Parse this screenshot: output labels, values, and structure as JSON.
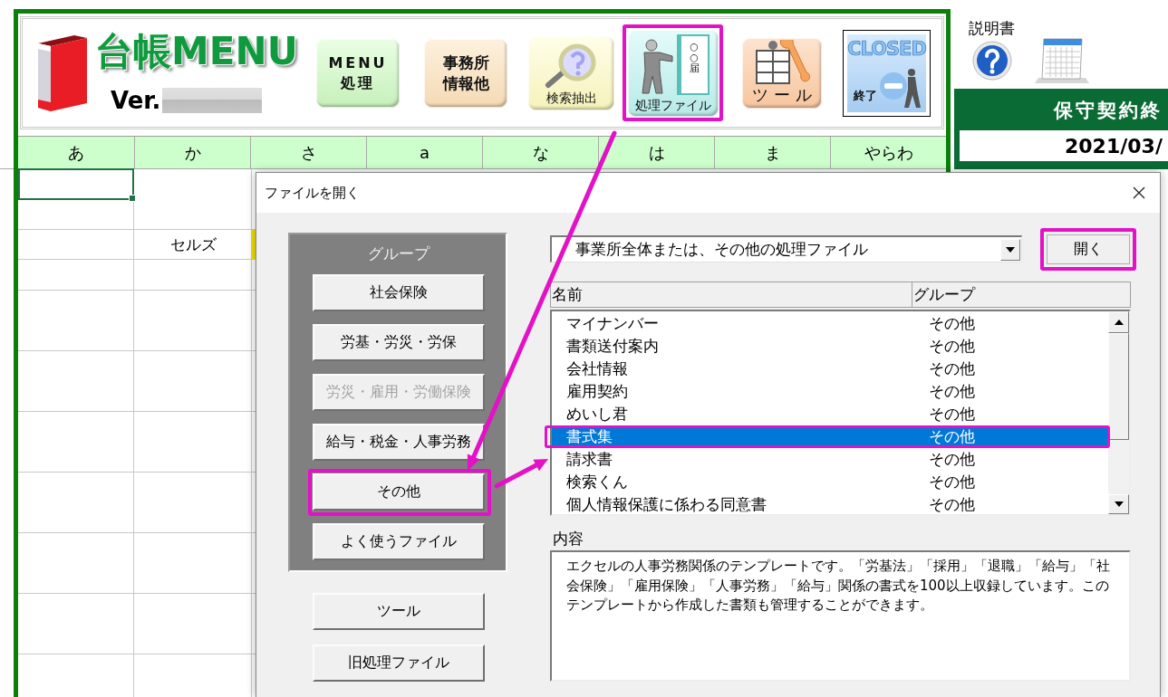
{
  "header": {
    "title": "台帳MENU",
    "version_label": "Ver.",
    "buttons": [
      {
        "kind": "menu",
        "lines": [
          "MENU",
          "処理"
        ],
        "highlighted": false
      },
      {
        "kind": "office",
        "lines": [
          "事務所",
          "情報他"
        ],
        "highlighted": false
      },
      {
        "kind": "search",
        "lines": [
          "検索抽出"
        ],
        "highlighted": false
      },
      {
        "kind": "files",
        "lines": [
          "処理ファイル"
        ],
        "icon_text": "○○届",
        "highlighted": true
      },
      {
        "kind": "tools",
        "lines": [
          "ツール"
        ],
        "highlighted": false
      },
      {
        "kind": "close",
        "lines": [
          "CLOSED",
          "終了"
        ],
        "highlighted": false
      }
    ]
  },
  "index_tabs": [
    {
      "label": "あ",
      "selected": false
    },
    {
      "label": "か",
      "selected": false
    },
    {
      "label": "さ",
      "selected": false
    },
    {
      "label": "a",
      "selected": false
    },
    {
      "label": "な",
      "selected": false
    },
    {
      "label": "は",
      "selected": false
    },
    {
      "label": "ま",
      "selected": false
    },
    {
      "label": "やらわ",
      "selected": false
    }
  ],
  "sheet": {
    "cell_text": "セルズ"
  },
  "manual": {
    "label": "説明書"
  },
  "contract_panel": {
    "title": "保守契約終",
    "date": "2021/03/"
  },
  "dialog": {
    "title": "ファイルを開く",
    "group_panel": {
      "title": "グループ",
      "buttons": [
        {
          "label": "社会保険",
          "disabled": false,
          "highlighted": false
        },
        {
          "label": "労基・労災・労保",
          "disabled": false,
          "highlighted": false
        },
        {
          "label": "労災・雇用・労働保険",
          "disabled": true,
          "highlighted": false
        },
        {
          "label": "給与・税金・人事労務",
          "disabled": false,
          "highlighted": false
        },
        {
          "label": "その他",
          "disabled": false,
          "highlighted": true
        },
        {
          "label": "よく使うファイル",
          "disabled": false,
          "highlighted": false
        }
      ]
    },
    "extra_buttons": [
      {
        "label": "ツール"
      },
      {
        "label": "旧処理ファイル"
      }
    ],
    "category_select": {
      "value": "事業所全体または、その他の処理ファイル"
    },
    "open_button": {
      "label": "開く",
      "highlighted": true
    },
    "file_list": {
      "columns": [
        "名前",
        "グループ"
      ],
      "rows": [
        {
          "name": "マイナンバー",
          "group": "その他",
          "selected": false,
          "highlighted": false
        },
        {
          "name": "書類送付案内",
          "group": "その他",
          "selected": false,
          "highlighted": false
        },
        {
          "name": "会社情報",
          "group": "その他",
          "selected": false,
          "highlighted": false
        },
        {
          "name": "雇用契約",
          "group": "その他",
          "selected": false,
          "highlighted": false
        },
        {
          "name": "めいし君",
          "group": "その他",
          "selected": false,
          "highlighted": false
        },
        {
          "name": "書式集",
          "group": "その他",
          "selected": true,
          "highlighted": true
        },
        {
          "name": "請求書",
          "group": "その他",
          "selected": false,
          "highlighted": false
        },
        {
          "name": "検索くん",
          "group": "その他",
          "selected": false,
          "highlighted": false
        },
        {
          "name": "個人情報保護に係わる同意書",
          "group": "その他",
          "selected": false,
          "highlighted": false
        }
      ]
    },
    "description": {
      "label": "内容",
      "text": "エクセルの人事労務関係のテンプレートです。「労基法」「採用」「退職」「給与」「社会保険」「雇用保険」「人事労務」「給与」関係の書式を100以上収録しています。このテンプレートから作成した書類も管理することができます。"
    }
  }
}
